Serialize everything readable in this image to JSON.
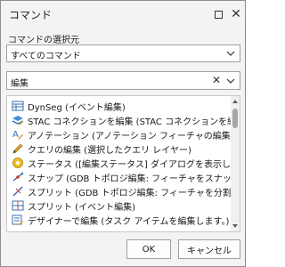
{
  "window": {
    "title": "コマンド"
  },
  "source": {
    "label": "コマンドの選択元",
    "value": "すべてのコマンド"
  },
  "search": {
    "value": "編集"
  },
  "list": {
    "items": [
      {
        "icon": "dynseg-table-icon",
        "label": "DynSeg (イベント編集)"
      },
      {
        "icon": "stac-layers-icon",
        "label": "STAC コネクションを編集 (STAC コネクションを編..."
      },
      {
        "icon": "annotation-icon",
        "label": "アノテーション (アノテーション フィーチャの編集)"
      },
      {
        "icon": "pencil-icon",
        "label": "クエリの編集 (選択したクエリ レイヤー)"
      },
      {
        "icon": "status-icon",
        "label": "ステータス ([編集ステータス] ダイアログを表示しま..."
      },
      {
        "icon": "snap-icon",
        "label": "スナップ (GDB トポロジ編集: フィーチャをスナップす..."
      },
      {
        "icon": "split-icon",
        "label": "スプリット (GDB トポロジ編集: フィーチャを分割す..."
      },
      {
        "icon": "split-event-icon",
        "label": "スプリット (イベント編集)"
      },
      {
        "icon": "designer-icon",
        "label": "デザイナーで編集 (タスク アイテムを編集します。)"
      }
    ]
  },
  "buttons": {
    "ok": "OK",
    "cancel": "キャンセル"
  }
}
